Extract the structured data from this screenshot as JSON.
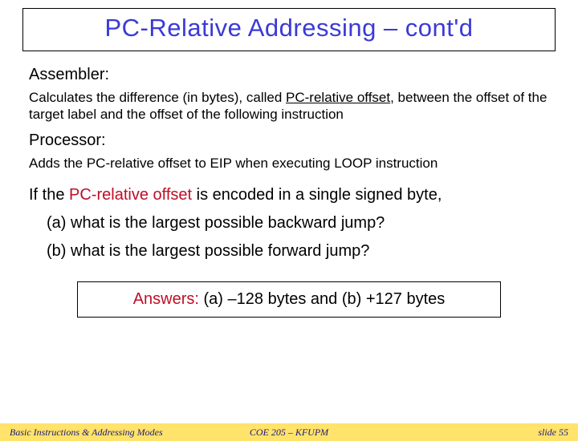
{
  "title": "PC-Relative Addressing – cont'd",
  "assembler": {
    "heading": "Assembler:",
    "body_pre": "Calculates the difference (in bytes), called ",
    "term": "PC-relative offset",
    "body_post": ", between the offset of the target label and the offset of the following instruction"
  },
  "processor": {
    "heading": "Processor:",
    "body": "Adds the PC-relative offset to EIP when executing LOOP instruction"
  },
  "question": {
    "pre": "If the ",
    "highlight": "PC-relative offset",
    "post": " is encoded in a single signed byte,",
    "a": "(a) what is the largest possible backward jump?",
    "b": "(b) what is the largest possible forward jump?"
  },
  "answer": {
    "label": "Answers:",
    "text": " (a) –128 bytes and (b) +127 bytes"
  },
  "footer": {
    "left": "Basic Instructions & Addressing Modes",
    "center": "COE 205 – KFUPM",
    "right": "slide 55"
  }
}
